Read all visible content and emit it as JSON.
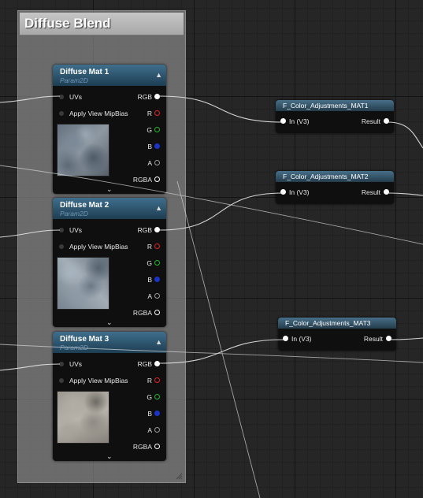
{
  "comment": {
    "title": "Diffuse Blend"
  },
  "texture_nodes": [
    {
      "title": "Diffuse Mat 1",
      "subtitle": "Param2D",
      "inputs": [
        "UVs",
        "Apply View MipBias"
      ],
      "outputs": [
        "RGB",
        "R",
        "G",
        "B",
        "A",
        "RGBA"
      ]
    },
    {
      "title": "Diffuse Mat 2",
      "subtitle": "Param2D",
      "inputs": [
        "UVs",
        "Apply View MipBias"
      ],
      "outputs": [
        "RGB",
        "R",
        "G",
        "B",
        "A",
        "RGBA"
      ]
    },
    {
      "title": "Diffuse Mat 3",
      "subtitle": "Param2D",
      "inputs": [
        "UVs",
        "Apply View MipBias"
      ],
      "outputs": [
        "RGB",
        "R",
        "G",
        "B",
        "A",
        "RGBA"
      ]
    }
  ],
  "function_nodes": [
    {
      "title": "F_Color_Adjustments_MAT1",
      "input": "In (V3)",
      "output": "Result"
    },
    {
      "title": "F_Color_Adjustments_MAT2",
      "input": "In (V3)",
      "output": "Result"
    },
    {
      "title": "F_Color_Adjustments_MAT3",
      "input": "In (V3)",
      "output": "Result"
    }
  ],
  "pin_colors": {
    "R": "#e0262a",
    "G": "#21b82b",
    "B": "#1b33c8",
    "A": "#9a9a9a",
    "RGB": "#ffffff",
    "RGBA": "#ffffff"
  },
  "icons": {
    "collapse": "chevron-up-icon",
    "expand": "chevron-down-icon",
    "resize": "resize-grip-icon"
  }
}
